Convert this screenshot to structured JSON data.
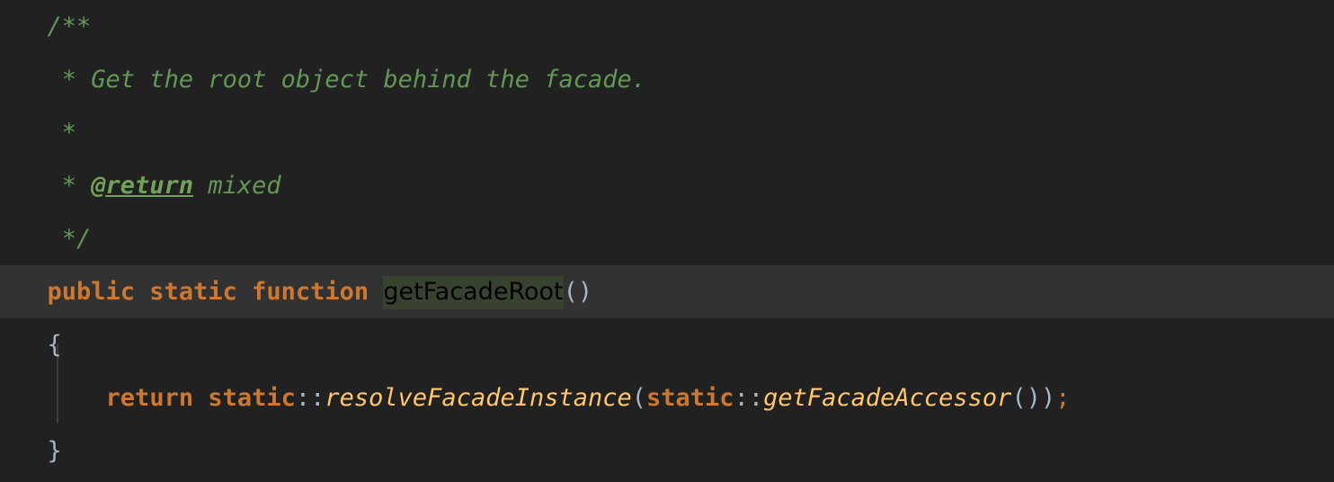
{
  "editor": {
    "language": "php",
    "theme": "darcula-dark",
    "background_color": "#212121",
    "current_line_highlight_color": "#323232",
    "identifier_highlight_color": "#37432f",
    "indent_guide_color": "#3b3d3e"
  },
  "colors": {
    "comment": "#629755",
    "doc_tag": "#72a15a",
    "keyword": "#cc7832",
    "method_name": "#ffc66d",
    "punctuation": "#a9b7c6",
    "semicolon": "#cc7832"
  },
  "code": {
    "lines": [
      {
        "id": "line-doc-open",
        "indent": "  ",
        "current": false,
        "indent_guide": false,
        "tokens": [
          {
            "name": "comment-block-open",
            "type": "comment",
            "text": "/**"
          }
        ]
      },
      {
        "id": "line-doc-summary",
        "indent": "   ",
        "current": false,
        "indent_guide": false,
        "tokens": [
          {
            "name": "comment-summary",
            "type": "comment",
            "text": "* Get the root object behind the facade."
          }
        ]
      },
      {
        "id": "line-doc-blank",
        "indent": "   ",
        "current": false,
        "indent_guide": false,
        "tokens": [
          {
            "name": "comment-blank",
            "type": "comment",
            "text": "*"
          }
        ]
      },
      {
        "id": "line-doc-return",
        "indent": "   ",
        "current": false,
        "indent_guide": false,
        "tokens": [
          {
            "name": "comment-asterisk",
            "type": "comment",
            "text": "* "
          },
          {
            "name": "doc-tag-return",
            "type": "doctag",
            "text": "@return"
          },
          {
            "name": "doc-return-type",
            "type": "comment",
            "text": " mixed"
          }
        ]
      },
      {
        "id": "line-doc-close",
        "indent": "   ",
        "current": false,
        "indent_guide": false,
        "tokens": [
          {
            "name": "comment-block-close",
            "type": "comment",
            "text": "*/"
          }
        ]
      },
      {
        "id": "line-signature",
        "indent": "  ",
        "current": true,
        "indent_guide": false,
        "tokens": [
          {
            "name": "keyword-public",
            "type": "keyword",
            "text": "public static function "
          },
          {
            "name": "method-name-getfacaderoot",
            "type": "ident-highlight",
            "text": "getFacadeRoot"
          },
          {
            "name": "signature-parens",
            "type": "punct",
            "text": "()"
          }
        ]
      },
      {
        "id": "line-open-brace",
        "indent": "  ",
        "current": false,
        "indent_guide": false,
        "tokens": [
          {
            "name": "open-brace",
            "type": "brace",
            "text": "{"
          }
        ]
      },
      {
        "id": "line-return-statement",
        "indent": "      ",
        "current": false,
        "indent_guide": true,
        "tokens": [
          {
            "name": "keyword-return-static",
            "type": "keyword",
            "text": "return static"
          },
          {
            "name": "scope-resolution-1",
            "type": "punct",
            "text": "::"
          },
          {
            "name": "call-resolve-facade-instance",
            "type": "method-italic",
            "text": "resolveFacadeInstance"
          },
          {
            "name": "open-paren-1",
            "type": "punct",
            "text": "("
          },
          {
            "name": "keyword-static-2",
            "type": "keyword",
            "text": "static"
          },
          {
            "name": "scope-resolution-2",
            "type": "punct",
            "text": "::"
          },
          {
            "name": "call-get-facade-accessor",
            "type": "method-italic",
            "text": "getFacadeAccessor"
          },
          {
            "name": "inner-parens",
            "type": "punct",
            "text": "()"
          },
          {
            "name": "close-paren-1",
            "type": "punct",
            "text": ")"
          },
          {
            "name": "statement-terminator",
            "type": "semi",
            "text": ";"
          }
        ]
      },
      {
        "id": "line-close-brace",
        "indent": "  ",
        "current": false,
        "indent_guide": false,
        "tokens": [
          {
            "name": "close-brace",
            "type": "brace",
            "text": "}"
          }
        ]
      }
    ]
  }
}
